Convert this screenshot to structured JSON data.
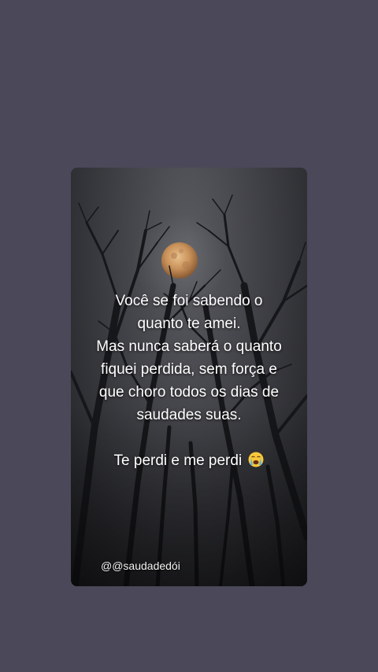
{
  "post": {
    "quote_lines": [
      "Você se foi sabendo o",
      "quanto te amei.",
      "Mas nunca saberá o quanto",
      "fiquei perdida, sem força e",
      "que choro todos os dias de",
      "saudades suas."
    ],
    "closing_line": "Te perdi e me perdi",
    "closing_emoji": "loudly-crying-face-emoji",
    "handle": "@@saudadedói"
  },
  "colors": {
    "page_background": "#4a4859",
    "card_sky": "#3f4045",
    "moon": "#c9925a",
    "text": "#ffffff"
  }
}
